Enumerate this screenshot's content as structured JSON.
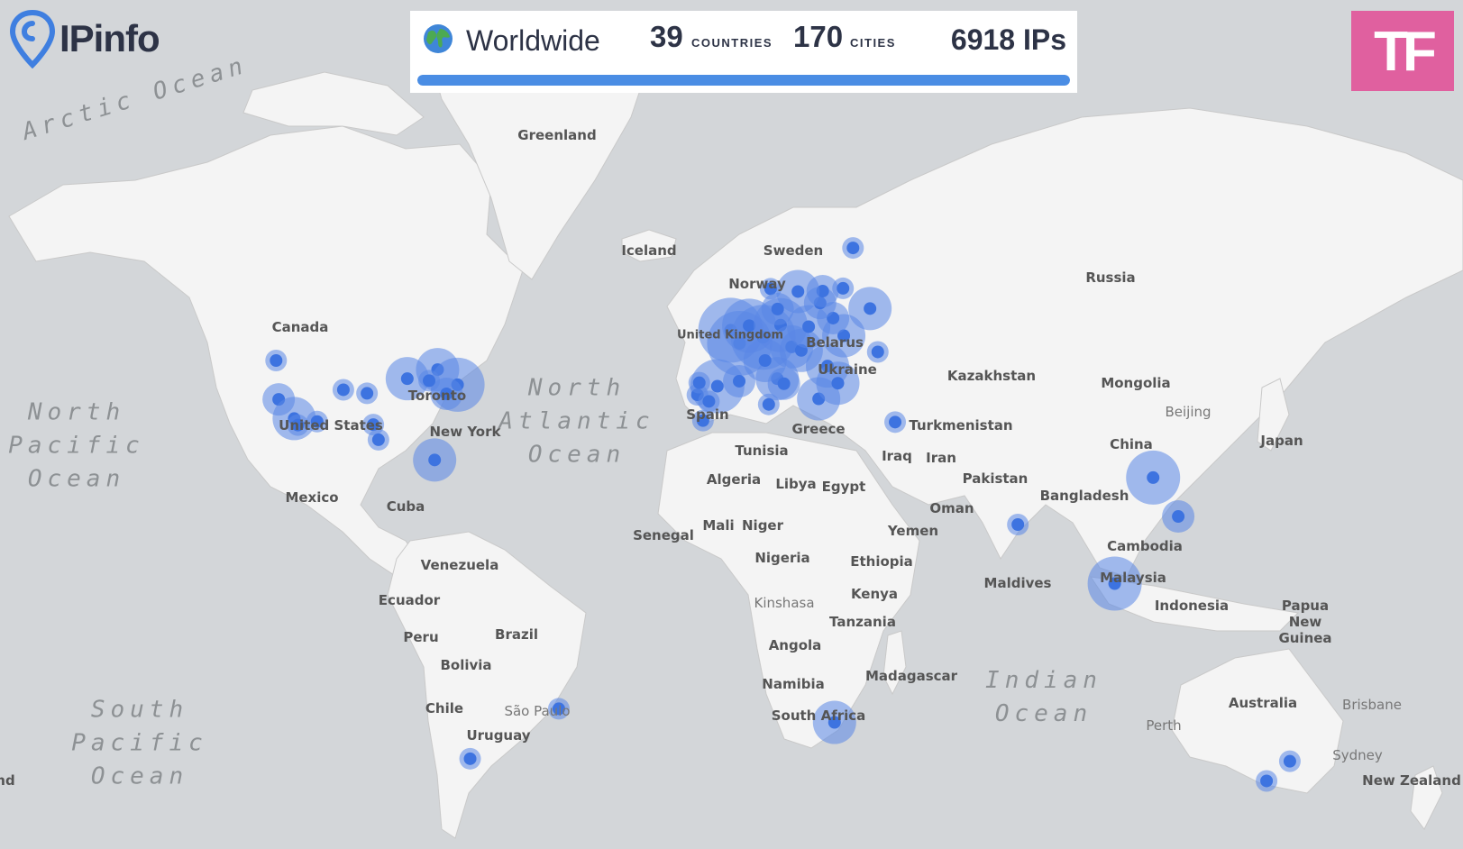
{
  "brand": {
    "name": "IPinfo"
  },
  "stats": {
    "scope": "Worldwide",
    "countries": "39",
    "countries_label": "COUNTRIES",
    "cities": "170",
    "cities_label": "CITIES",
    "ips": "6918 IPs",
    "progress": 1.0
  },
  "badge": {
    "text": "TF",
    "color": "#e0609f"
  },
  "colors": {
    "water": "#d3d6d9",
    "land": "#f4f4f4",
    "dot": "#3d73e0",
    "bar": "#4a8de4"
  },
  "places": {
    "greenland": "Greenland",
    "iceland": "Iceland",
    "sweden": "Sweden",
    "norway": "Norway",
    "russia": "Russia",
    "canada": "Canada",
    "united_kingdom": "United Kingdom",
    "belarus": "Belarus",
    "ukraine": "Ukraine",
    "kazakhstan": "Kazakhstan",
    "mongolia": "Mongolia",
    "beijing": "Beijing",
    "toronto": "Toronto",
    "united_states": "United States",
    "new_york": "New York",
    "spain": "Spain",
    "greece": "Greece",
    "turkmenistan": "Turkmenistan",
    "china": "China",
    "japan": "Japan",
    "tunisia": "Tunisia",
    "iraq": "Iraq",
    "iran": "Iran",
    "algeria": "Algeria",
    "libya": "Libya",
    "egypt": "Egypt",
    "pakistan": "Pakistan",
    "mexico": "Mexico",
    "cuba": "Cuba",
    "oman": "Oman",
    "bangladesh": "Bangladesh",
    "yemen": "Yemen",
    "senegal": "Senegal",
    "mali": "Mali",
    "niger": "Niger",
    "cambodia": "Cambodia",
    "nigeria": "Nigeria",
    "ethiopia": "Ethiopia",
    "venezuela": "Venezuela",
    "malaysia": "Malaysia",
    "maldives": "Maldives",
    "ecuador": "Ecuador",
    "kenya": "Kenya",
    "indonesia": "Indonesia",
    "kinshasa": "Kinshasa",
    "papua_new_guinea": "Papua New Guinea",
    "tanzania": "Tanzania",
    "peru": "Peru",
    "brazil": "Brazil",
    "angola": "Angola",
    "bolivia": "Bolivia",
    "madagascar": "Madagascar",
    "namibia": "Namibia",
    "australia": "Australia",
    "brisbane": "Brisbane",
    "chile": "Chile",
    "sao_paulo": "São Paulo",
    "south_africa": "South Africa",
    "perth": "Perth",
    "uruguay": "Uruguay",
    "sydney": "Sydney",
    "new_zealand": "New Zealand",
    "edge_fragment": "nd"
  },
  "oceans": {
    "arctic": "Arctic Ocean",
    "north_pacific": "North\nPacific\nOcean",
    "north_atlantic": "North\nAtlantic\nOcean",
    "south_pacific": "South\nPacific\nOcean",
    "indian": "Indian\nOcean"
  },
  "icons": {
    "logo": "ipinfo-pin-icon",
    "globe": "globe-icon"
  },
  "dot_locations": [
    {
      "lon": -122.4,
      "lat": 37.8,
      "size": 2
    },
    {
      "lon": -118.2,
      "lat": 34.0,
      "size": 3
    },
    {
      "lon": -117.2,
      "lat": 32.7,
      "size": 1
    },
    {
      "lon": -112.0,
      "lat": 33.4,
      "size": 1
    },
    {
      "lon": -123.1,
      "lat": 45.5,
      "size": 1
    },
    {
      "lon": -104.9,
      "lat": 39.7,
      "size": 1
    },
    {
      "lon": -96.8,
      "lat": 32.8,
      "size": 1
    },
    {
      "lon": -95.4,
      "lat": 29.8,
      "size": 1
    },
    {
      "lon": -87.6,
      "lat": 41.9,
      "size": 3
    },
    {
      "lon": -79.4,
      "lat": 43.7,
      "size": 3
    },
    {
      "lon": -74.0,
      "lat": 40.7,
      "size": 4
    },
    {
      "lon": -77.0,
      "lat": 38.9,
      "size": 2
    },
    {
      "lon": -80.2,
      "lat": 25.8,
      "size": 3
    },
    {
      "lon": -98.5,
      "lat": 39.0,
      "size": 1
    },
    {
      "lon": -81.7,
      "lat": 41.5,
      "size": 1
    },
    {
      "lon": -46.6,
      "lat": -23.5,
      "size": 1
    },
    {
      "lon": -70.6,
      "lat": -33.4,
      "size": 1
    },
    {
      "lon": -0.1,
      "lat": 51.5,
      "size": 5
    },
    {
      "lon": 2.3,
      "lat": 48.9,
      "size": 5
    },
    {
      "lon": 8.7,
      "lat": 50.1,
      "size": 5
    },
    {
      "lon": 4.9,
      "lat": 52.4,
      "size": 4
    },
    {
      "lon": 13.4,
      "lat": 52.5,
      "size": 4
    },
    {
      "lon": -3.7,
      "lat": 40.4,
      "size": 4
    },
    {
      "lon": -9.1,
      "lat": 38.7,
      "size": 1
    },
    {
      "lon": -6.0,
      "lat": 37.4,
      "size": 1
    },
    {
      "lon": -8.6,
      "lat": 41.1,
      "size": 1
    },
    {
      "lon": 2.2,
      "lat": 41.4,
      "size": 2
    },
    {
      "lon": 12.5,
      "lat": 41.9,
      "size": 3
    },
    {
      "lon": 9.2,
      "lat": 45.5,
      "size": 3
    },
    {
      "lon": 14.3,
      "lat": 40.9,
      "size": 2
    },
    {
      "lon": 16.4,
      "lat": 48.2,
      "size": 3
    },
    {
      "lon": 19.0,
      "lat": 47.5,
      "size": 3
    },
    {
      "lon": 21.0,
      "lat": 52.2,
      "size": 3
    },
    {
      "lon": 26.1,
      "lat": 44.4,
      "size": 3
    },
    {
      "lon": 23.7,
      "lat": 37.9,
      "size": 3
    },
    {
      "lon": 30.5,
      "lat": 50.4,
      "size": 3
    },
    {
      "lon": 27.6,
      "lat": 53.9,
      "size": 2
    },
    {
      "lon": 24.1,
      "lat": 56.9,
      "size": 2
    },
    {
      "lon": 24.8,
      "lat": 59.4,
      "size": 2
    },
    {
      "lon": 18.1,
      "lat": 59.3,
      "size": 3
    },
    {
      "lon": 10.7,
      "lat": 59.9,
      "size": 1
    },
    {
      "lon": 12.6,
      "lat": 55.7,
      "size": 2
    },
    {
      "lon": 37.6,
      "lat": 55.8,
      "size": 3
    },
    {
      "lon": 30.3,
      "lat": 60.0,
      "size": 1
    },
    {
      "lon": 33.0,
      "lat": 68.9,
      "size": 1
    },
    {
      "lon": 28.9,
      "lat": 41.0,
      "size": 3
    },
    {
      "lon": 39.7,
      "lat": 47.2,
      "size": 1
    },
    {
      "lon": 44.4,
      "lat": 33.3,
      "size": 1
    },
    {
      "lon": 10.2,
      "lat": 36.8,
      "size": 1
    },
    {
      "lon": -7.6,
      "lat": 33.6,
      "size": 1
    },
    {
      "lon": 77.6,
      "lat": 13.0,
      "size": 1
    },
    {
      "lon": 114.2,
      "lat": 22.3,
      "size": 4
    },
    {
      "lon": 121.0,
      "lat": 14.6,
      "size": 2
    },
    {
      "lon": 103.8,
      "lat": 1.3,
      "size": 4
    },
    {
      "lon": 28.0,
      "lat": -26.2,
      "size": 3
    },
    {
      "lon": 151.2,
      "lat": -33.9,
      "size": 1
    },
    {
      "lon": 144.9,
      "lat": -37.8,
      "size": 1
    }
  ]
}
